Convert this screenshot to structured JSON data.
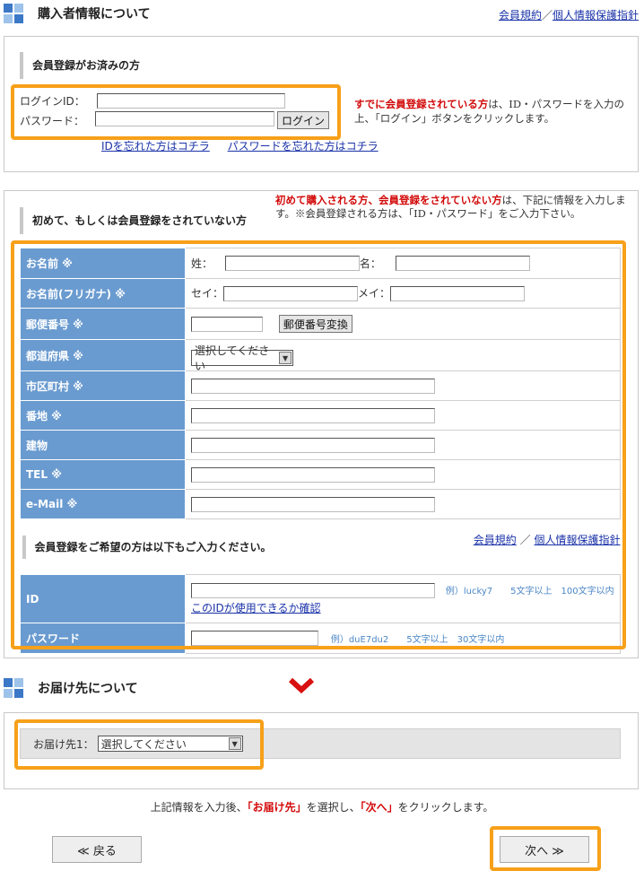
{
  "buyer_section": {
    "title": "購入者情報について",
    "links": {
      "terms": "会員規約",
      "separator": "／",
      "privacy": "個人情報保護指針"
    }
  },
  "login_box": {
    "heading": "会員登録がお済みの方",
    "login_id_label": "ログインID：",
    "password_label": "パスワード：",
    "login_button": "ログイン",
    "note": "は、ID・パスワードを入力の上、「ログイン」ボタンをクリックします。",
    "note_strong": "すでに会員登録されている方",
    "forgot_id": "IDを忘れた方はコチラ",
    "forgot_password": "パスワードを忘れた方はコチラ"
  },
  "new_box": {
    "heading": "初めて、もしくは会員登録をされていない方",
    "note_strong": "初めて購入される方、会員登録をされていない方",
    "note": "は、下記に情報を入力します。※会員登録される方は、「ID・パスワード」をご入力下さい。",
    "rows": {
      "name": "お名前 ※",
      "name_kana": "お名前(フリガナ) ※",
      "postal": "郵便番号 ※",
      "prefecture": "都道府県 ※",
      "city": "市区町村 ※",
      "address": "番地 ※",
      "building": "建物",
      "tel": "TEL ※",
      "email": "e-Mail ※"
    },
    "sei_label": "姓：",
    "mei_label": "名：",
    "sei_kana_label": "セイ：",
    "mei_kana_label": "メイ：",
    "postal_convert_button": "郵便番号変換",
    "prefecture_selected": "選択してください",
    "register_heading": "会員登録をご希望の方は以下もご入力ください。",
    "terms_link": "会員規約",
    "link_separator": "／",
    "privacy_link": "個人情報保護指針",
    "id_label": "ID",
    "id_hint": "例）lucky7　　5文字以上　100文字以内",
    "id_check_link": "このIDが使用できるか確認",
    "password_label": "パスワード",
    "password_hint": "例）duE7du2　　5文字以上　30文字以内"
  },
  "delivery_section": {
    "title": "お届け先について",
    "label": "お届け先1：",
    "selected": "選択してください"
  },
  "instruction": {
    "before": "上記情報を入力後、",
    "highlight1": "「お届け先」",
    "middle": "を選択し、",
    "highlight2": "「次へ」",
    "after": "をクリックします。"
  },
  "nav": {
    "back": "≪ 戻る",
    "next": "次へ ≫"
  },
  "colors": {
    "accent_orange": "#f7a01a",
    "label_blue": "#6a9bd0",
    "link_blue": "#1a32a8",
    "red": "#d20a0a"
  }
}
